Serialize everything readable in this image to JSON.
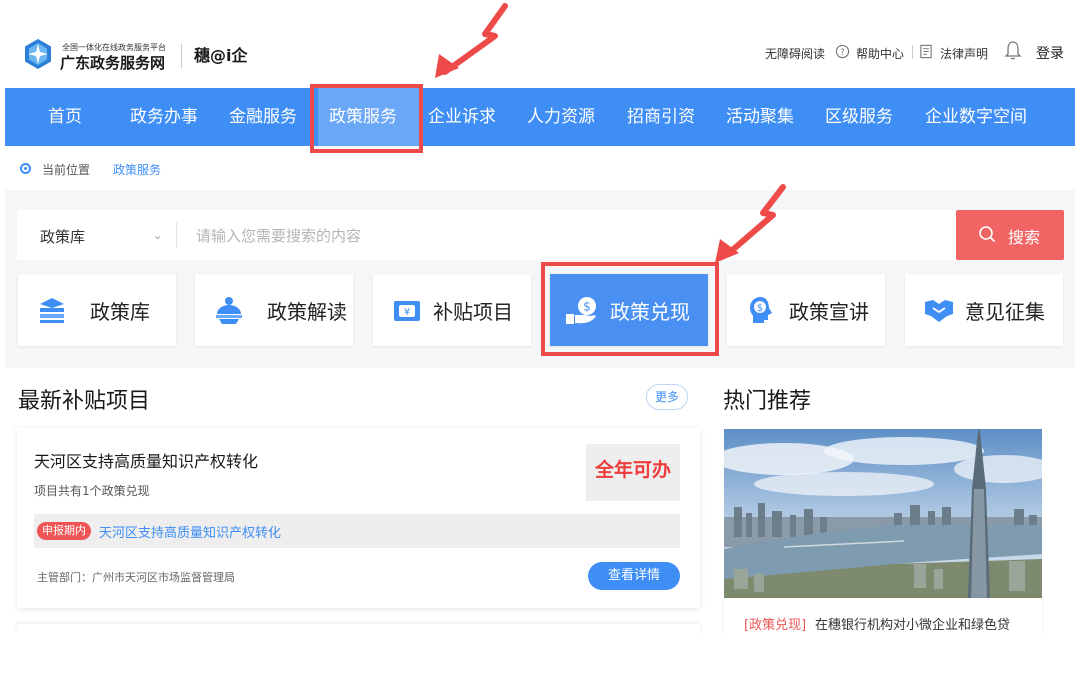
{
  "header": {
    "site_small": "全国一体化在线政务服务平台",
    "site_name": "广东政务服务网",
    "sub_brand": "穗@i企",
    "links": {
      "accessibility": "无障碍阅读",
      "help": "帮助中心",
      "legal": "法律声明",
      "login": "登录"
    }
  },
  "nav": {
    "items": [
      "首页",
      "政务办事",
      "金融服务",
      "政策服务",
      "企业诉求",
      "人力资源",
      "招商引资",
      "活动聚集",
      "区级服务",
      "企业数字空间"
    ],
    "active_index": 3
  },
  "breadcrumb": {
    "label": "当前位置",
    "current": "政策服务"
  },
  "search": {
    "category": "政策库",
    "placeholder": "请输入您需要搜索的内容",
    "button": "搜索"
  },
  "tiles": [
    {
      "label": "政策库",
      "icon": "books-icon"
    },
    {
      "label": "政策解读",
      "icon": "globe-person-icon"
    },
    {
      "label": "补贴项目",
      "icon": "wallet-icon"
    },
    {
      "label": "政策兑现",
      "icon": "hand-money-icon"
    },
    {
      "label": "政策宣讲",
      "icon": "head-dollar-icon"
    },
    {
      "label": "意见征集",
      "icon": "handshake-icon"
    }
  ],
  "subsidy": {
    "title": "最新补贴项目",
    "more": "更多",
    "card": {
      "title": "天河区支持高质量知识产权转化",
      "subtitle": "项目共有1个政策兑现",
      "status": "全年可办",
      "badge": "申报期内",
      "link": "天河区支持高质量知识产权转化",
      "dept": "主管部门：广州市天河区市场监督管理局",
      "detail_button": "查看详情"
    }
  },
  "hot": {
    "title": "热门推荐",
    "tag": "[政策兑现]",
    "text": "在穗银行机构对小微企业和绿色贷"
  },
  "colors": {
    "primary": "#3f8ef5",
    "accent_red": "#ee4a4a",
    "search_button": "#f26363"
  }
}
